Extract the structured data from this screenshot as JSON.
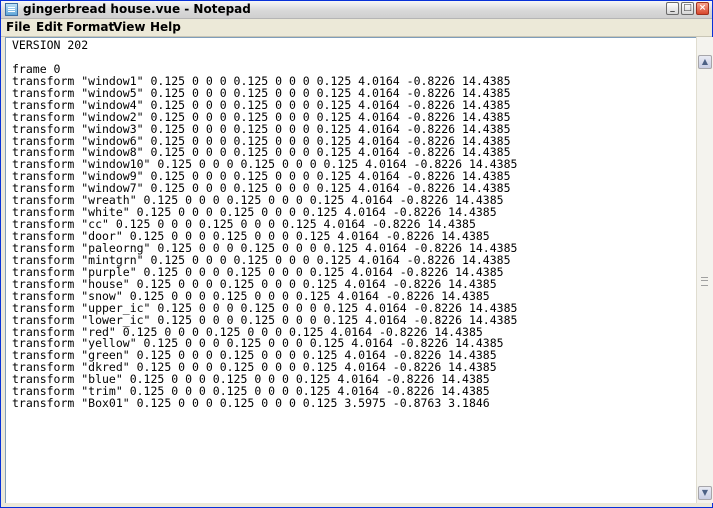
{
  "window": {
    "title": "gingerbread house.vue - Notepad",
    "controls": {
      "minimize": "_",
      "maximize": "□",
      "close": "×"
    }
  },
  "menu": [
    "File",
    "Edit",
    "Format",
    "View",
    "Help"
  ],
  "editor": {
    "lines": [
      "VERSION 202",
      "",
      "frame 0",
      "transform \"window1\" 0.125 0 0 0 0.125 0 0 0 0.125 4.0164 -0.8226 14.4385",
      "transform \"window5\" 0.125 0 0 0 0.125 0 0 0 0.125 4.0164 -0.8226 14.4385",
      "transform \"window4\" 0.125 0 0 0 0.125 0 0 0 0.125 4.0164 -0.8226 14.4385",
      "transform \"window2\" 0.125 0 0 0 0.125 0 0 0 0.125 4.0164 -0.8226 14.4385",
      "transform \"window3\" 0.125 0 0 0 0.125 0 0 0 0.125 4.0164 -0.8226 14.4385",
      "transform \"window6\" 0.125 0 0 0 0.125 0 0 0 0.125 4.0164 -0.8226 14.4385",
      "transform \"window8\" 0.125 0 0 0 0.125 0 0 0 0.125 4.0164 -0.8226 14.4385",
      "transform \"window10\" 0.125 0 0 0 0.125 0 0 0 0.125 4.0164 -0.8226 14.4385",
      "transform \"window9\" 0.125 0 0 0 0.125 0 0 0 0.125 4.0164 -0.8226 14.4385",
      "transform \"window7\" 0.125 0 0 0 0.125 0 0 0 0.125 4.0164 -0.8226 14.4385",
      "transform \"wreath\" 0.125 0 0 0 0.125 0 0 0 0.125 4.0164 -0.8226 14.4385",
      "transform \"white\" 0.125 0 0 0 0.125 0 0 0 0.125 4.0164 -0.8226 14.4385",
      "transform \"cc\" 0.125 0 0 0 0.125 0 0 0 0.125 4.0164 -0.8226 14.4385",
      "transform \"door\" 0.125 0 0 0 0.125 0 0 0 0.125 4.0164 -0.8226 14.4385",
      "transform \"paleorng\" 0.125 0 0 0 0.125 0 0 0 0.125 4.0164 -0.8226 14.4385",
      "transform \"mintgrn\" 0.125 0 0 0 0.125 0 0 0 0.125 4.0164 -0.8226 14.4385",
      "transform \"purple\" 0.125 0 0 0 0.125 0 0 0 0.125 4.0164 -0.8226 14.4385",
      "transform \"house\" 0.125 0 0 0 0.125 0 0 0 0.125 4.0164 -0.8226 14.4385",
      "transform \"snow\" 0.125 0 0 0 0.125 0 0 0 0.125 4.0164 -0.8226 14.4385",
      "transform \"upper_ic\" 0.125 0 0 0 0.125 0 0 0 0.125 4.0164 -0.8226 14.4385",
      "transform \"lower_ic\" 0.125 0 0 0 0.125 0 0 0 0.125 4.0164 -0.8226 14.4385",
      "transform \"red\" 0.125 0 0 0 0.125 0 0 0 0.125 4.0164 -0.8226 14.4385",
      "transform \"yellow\" 0.125 0 0 0 0.125 0 0 0 0.125 4.0164 -0.8226 14.4385",
      "transform \"green\" 0.125 0 0 0 0.125 0 0 0 0.125 4.0164 -0.8226 14.4385",
      "transform \"dkred\" 0.125 0 0 0 0.125 0 0 0 0.125 4.0164 -0.8226 14.4385",
      "transform \"blue\" 0.125 0 0 0 0.125 0 0 0 0.125 4.0164 -0.8226 14.4385",
      "transform \"trim\" 0.125 0 0 0 0.125 0 0 0 0.125 4.0164 -0.8226 14.4385",
      "transform \"Box01\" 0.125 0 0 0 0.125 0 0 0 0.125 3.5975 -0.8763 3.1846"
    ]
  },
  "scrollbar": {
    "up_icon": "scroll-up-icon",
    "down_icon": "scroll-down-icon"
  },
  "colors": {
    "window_border": "#0831d9",
    "editor_bg": "#ffffff",
    "text": "#000000"
  }
}
